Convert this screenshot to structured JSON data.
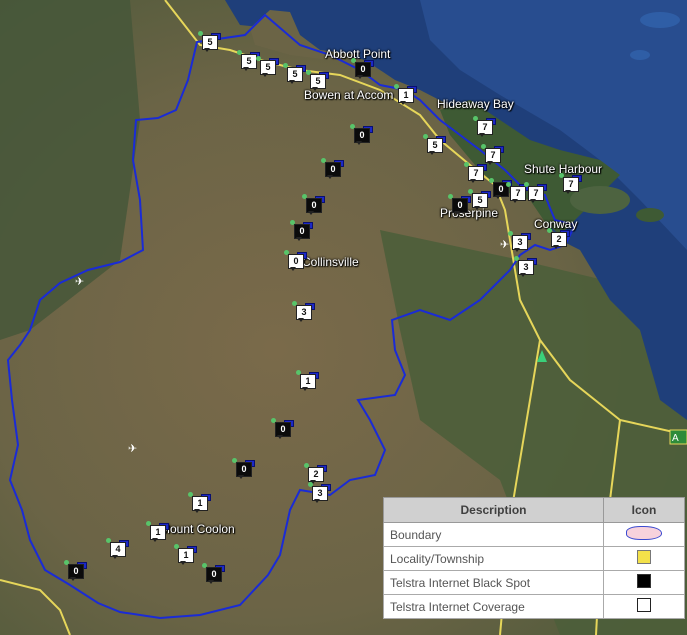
{
  "places": {
    "abbott_point": "Abbott Point",
    "bowen": "Bowen at Accom",
    "hideaway_bay": "Hideaway Bay",
    "shute_harbour": "Shute Harbour",
    "proserpine": "Proserpine",
    "conway": "Conway",
    "collinsville": "Collinsville",
    "mount_coolon": "Mount Coolon"
  },
  "road_sign": "A",
  "markers": [
    {
      "type": "coverage",
      "value": "5"
    },
    {
      "type": "coverage",
      "value": "5"
    },
    {
      "type": "coverage",
      "value": "5"
    },
    {
      "type": "coverage",
      "value": "5"
    },
    {
      "type": "coverage",
      "value": "5"
    },
    {
      "type": "blackspot",
      "value": "0"
    },
    {
      "type": "coverage",
      "value": "1"
    },
    {
      "type": "blackspot",
      "value": "0"
    },
    {
      "type": "blackspot",
      "value": "0"
    },
    {
      "type": "coverage",
      "value": "7"
    },
    {
      "type": "coverage",
      "value": "5"
    },
    {
      "type": "coverage",
      "value": "7"
    },
    {
      "type": "coverage",
      "value": "7"
    },
    {
      "type": "coverage",
      "value": "5"
    },
    {
      "type": "blackspot",
      "value": "0"
    },
    {
      "type": "coverage",
      "value": "7"
    },
    {
      "type": "coverage",
      "value": "7"
    },
    {
      "type": "coverage",
      "value": "7"
    },
    {
      "type": "blackspot",
      "value": "0"
    },
    {
      "type": "coverage",
      "value": "3"
    },
    {
      "type": "coverage",
      "value": "2"
    },
    {
      "type": "coverage",
      "value": "3"
    },
    {
      "type": "blackspot",
      "value": "0"
    },
    {
      "type": "blackspot",
      "value": "0"
    },
    {
      "type": "coverage",
      "value": "0"
    },
    {
      "type": "coverage",
      "value": "3"
    },
    {
      "type": "coverage",
      "value": "1"
    },
    {
      "type": "blackspot",
      "value": "0"
    },
    {
      "type": "blackspot",
      "value": "0"
    },
    {
      "type": "coverage",
      "value": "2"
    },
    {
      "type": "coverage",
      "value": "3"
    },
    {
      "type": "coverage",
      "value": "1"
    },
    {
      "type": "coverage",
      "value": "4"
    },
    {
      "type": "coverage",
      "value": "1"
    },
    {
      "type": "coverage",
      "value": "1"
    },
    {
      "type": "blackspot",
      "value": "0"
    },
    {
      "type": "blackspot",
      "value": "0"
    }
  ],
  "legend": {
    "header_description": "Description",
    "header_icon": "Icon",
    "rows": [
      {
        "label": "Boundary",
        "icon": "boundary-swatch-icon"
      },
      {
        "label": "Locality/Township",
        "icon": "yellow-pushpin-icon"
      },
      {
        "label": "Telstra Internet Black Spot",
        "icon": "black-spot-icon"
      },
      {
        "label": "Telstra Internet Coverage",
        "icon": "coverage-icon"
      }
    ]
  },
  "colors": {
    "boundary": "#1a2bd6",
    "roads": "#e6d65a",
    "sea": "#1f3f7a",
    "land": "#6b6446",
    "blackspot": "#0b0b0b",
    "coverage": "#ffffff",
    "flag": "#1c28c8"
  }
}
